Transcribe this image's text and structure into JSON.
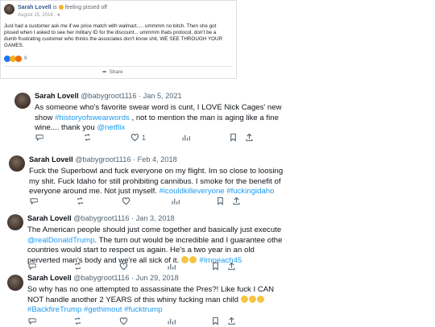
{
  "fb": {
    "name": "Sarah Lovell",
    "status_prefix": "is",
    "status": "feeling pissed off",
    "date": "August 15, 2016 ·",
    "text": [
      "Just had a customer ask me if we price match with walmart..... ummmm no bitch. Then she got",
      "pissed when I asked to see her military ID for the discount... ummmm thats protocol, don't be a",
      "dumb frustrating customer who thinks the associates don't know shit, WE SEE THROUGH YOUR",
      "GAMES."
    ],
    "reaction_count": "9",
    "share_label": "Share",
    "colors": {
      "like": "#1877f2",
      "haha": "#f7b125",
      "angry": "#e9710f"
    }
  },
  "tweets": [
    {
      "name": "Sarah Lovell",
      "handle": "@babygroot1116",
      "date": "· Jan 5, 2021",
      "lines": [
        [
          {
            "t": "As someone who's favorite swear word is cunt, I LOVE Nick Cages' new"
          }
        ],
        [
          {
            "t": "show "
          },
          {
            "t": "#historyofswearwords",
            "link": true
          },
          {
            "t": " , not to mention the man is aging like a fine"
          }
        ],
        [
          {
            "t": "wine.... thank you "
          },
          {
            "t": "@netflix",
            "link": true
          }
        ]
      ],
      "likes": "1"
    },
    {
      "name": "Sarah Lovell",
      "handle": "@babygroot1116",
      "date": "· Feb 4, 2018",
      "lines": [
        [
          {
            "t": "Fuck the Superbowl and fuck everyone on my flight. Im so close to loosing"
          }
        ],
        [
          {
            "t": "my shit. Fuck Idaho for still prohibiting cannibus. I smoke for the benefit of"
          }
        ],
        [
          {
            "t": "everyone around me. Not just myself. "
          },
          {
            "t": "#icouldkilleveryone #fuckingidaho",
            "link": true
          }
        ]
      ],
      "likes": ""
    },
    {
      "name": "Sarah Lovell",
      "handle": "@babygroot1116",
      "date": "· Jan 3, 2018",
      "lines": [
        [
          {
            "t": "The American people should just come together and basically just execute"
          }
        ],
        [
          {
            "t": "@realDonaldTrump",
            "link": true
          },
          {
            "t": ". The turn out would be incredible and I guarantee othe"
          }
        ],
        [
          {
            "t": "countries would start to respect us again. He's a two year in an old"
          }
        ],
        [
          {
            "t": "perverted man's body and we're all sick of it. "
          },
          {
            "emoji": 2
          },
          {
            "t": " "
          },
          {
            "t": "#Impeach45",
            "link": true
          }
        ]
      ],
      "likes": ""
    },
    {
      "name": "Sarah Lovell",
      "handle": "@babygroot1116",
      "date": "· Jun 29, 2018",
      "lines": [
        [
          {
            "t": "So why has no one attempted to assassinate the Pres?! Like fuck I CAN"
          }
        ],
        [
          {
            "t": "NOT handle another 2 YEARS of this whiny fucking man child "
          },
          {
            "emoji": 3
          }
        ],
        [
          {
            "t": "#BackfireTrump #gethimout #fucktrump",
            "link": true
          }
        ]
      ],
      "likes": ""
    }
  ]
}
